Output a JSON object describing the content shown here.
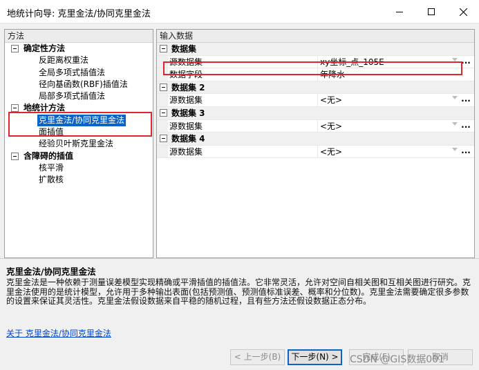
{
  "window": {
    "title": "地统计向导: 克里金法/协同克里金法"
  },
  "left_panel": {
    "header": "方法",
    "categories": [
      {
        "label": "确定性方法",
        "children": [
          "反距离权重法",
          "全局多项式插值法",
          "径向基函数(RBF)插值法",
          "局部多项式插值法"
        ]
      },
      {
        "label": "地统计方法",
        "children": [
          "克里金法/协同克里金法",
          "面插值",
          "经验贝叶斯克里金法"
        ]
      },
      {
        "label": "含障碍的插值",
        "children": [
          "核平滑",
          "扩散核"
        ]
      }
    ],
    "selected": "克里金法/协同克里金法"
  },
  "right_panel": {
    "header": "输入数据",
    "groups": [
      {
        "title": "数据集",
        "props": [
          {
            "name": "源数据集",
            "value": "xy坐标_点_105E"
          },
          {
            "name": "数据字段",
            "value": "年降水"
          }
        ]
      },
      {
        "title": "数据集 2",
        "props": [
          {
            "name": "源数据集",
            "value": "<无>"
          }
        ]
      },
      {
        "title": "数据集 3",
        "props": [
          {
            "name": "源数据集",
            "value": "<无>"
          }
        ]
      },
      {
        "title": "数据集 4",
        "props": [
          {
            "name": "源数据集",
            "value": "<无>"
          }
        ]
      }
    ],
    "ellipsis": "..."
  },
  "description": {
    "title": "克里金法/协同克里金法",
    "body": "克里金法是一种依赖于测量误差模型实现精确或平滑插值的插值法。它非常灵活，允许对空间自相关图和互相关图进行研究。克里金法使用的是统计模型，允许用于多种输出表面(包括预测值、预测值标准误差、概率和分位数)。克里金法需要确定很多参数的设置来保证其灵活性。克里金法假设数据来自平稳的随机过程，且有些方法还假设数据正态分布。",
    "link": "关于 克里金法/协同克里金法"
  },
  "buttons": {
    "prev": "< 上一步(B)",
    "next": "下一步(N) >",
    "finish": "完成(F)",
    "cancel": "取消"
  },
  "watermark": "CSDN @GIS数据001",
  "colors": {
    "highlight_box": "#e0242b",
    "selection": "#0a64c8",
    "link": "#0044cc"
  }
}
